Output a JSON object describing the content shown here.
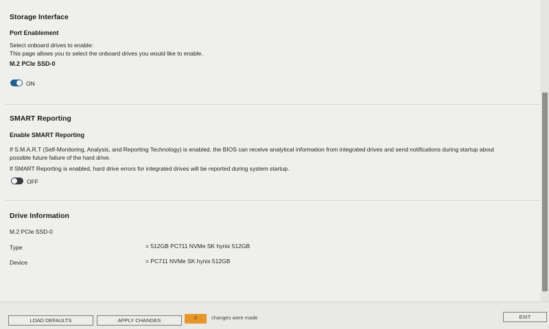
{
  "storage_interface": {
    "title": "Storage Interface",
    "port_enablement_title": "Port Enablement",
    "line1": "Select onboard drives to enable:",
    "line2": "This page allows you to select the onboard drives you would like to enable.",
    "drive_label": "M.2 PCIe SSD-0",
    "toggle_state_label": "ON",
    "toggle_on": true
  },
  "smart_reporting": {
    "title": "SMART Reporting",
    "enable_title": "Enable SMART Reporting",
    "line1": "If S.M.A.R.T (Self-Monitoring, Analysis, and Reporting Technology) is enabled, the BIOS can receive analytical information from integrated drives and send notifications during startup about",
    "line2": "possible future failure of the hard drive.",
    "line3": "If SMART Reporting is enabled, hard drive errors for integrated drives will be reported during system startup.",
    "toggle_state_label": "OFF",
    "toggle_on": false
  },
  "drive_information": {
    "title": "Drive Information",
    "drive_name": "M.2 PCIe SSD-0",
    "rows": [
      {
        "label": "Type",
        "value": "= 512GB PC711 NVMe SK hynix 512GB"
      },
      {
        "label": "Device",
        "value": "= PC711 NVMe SK hynix 512GB"
      }
    ]
  },
  "footer": {
    "load_defaults_label": "LOAD DEFAULTS",
    "apply_changes_label": "APPLY CHANGES",
    "changes_count": "0",
    "changes_text": "changes were made",
    "exit_label": "EXIT"
  },
  "colors": {
    "toggle_on": "#1f5f8b",
    "toggle_off": "#3a3a3a",
    "counter_badge": "#e7962a"
  }
}
